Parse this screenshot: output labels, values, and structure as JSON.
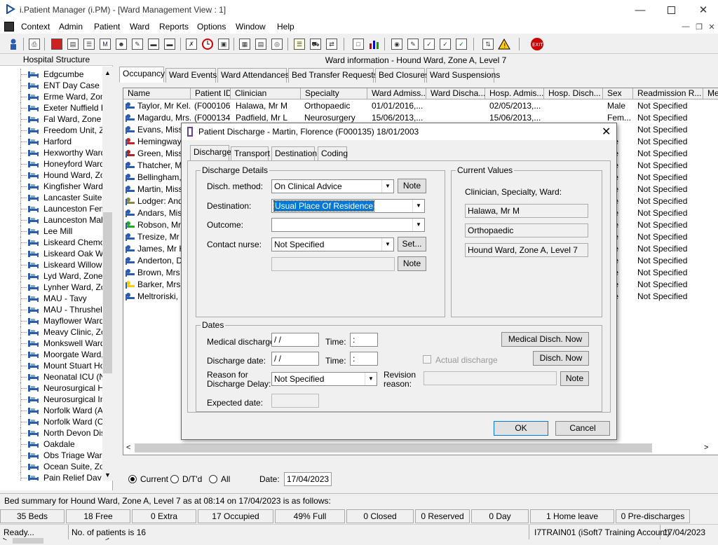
{
  "window": {
    "title": "i.Patient Manager (i.PM) - [Ward Management View : 1]"
  },
  "menu": [
    "Context",
    "Admin",
    "Patient",
    "Ward",
    "Reports",
    "Options",
    "Window",
    "Help"
  ],
  "left_panel": {
    "header": "Hospital Structure",
    "items": [
      "Edgcumbe",
      "ENT Day Case U",
      "Erme Ward, Zone",
      "Exeter Nuffield He",
      "Fal Ward, Zone E",
      "Freedom Unit, Zo",
      "Harford",
      "Hexworthy Ward,",
      "Honeyford Ward,",
      "Hound Ward, Zor",
      "Kingfisher Ward",
      "Lancaster Suite, Z",
      "Launceston Fema",
      "Launceston Male",
      "Lee Mill",
      "Liskeard Chemo D",
      "Liskeard Oak Wa",
      "Liskeard Willow V",
      "Lyd Ward, Zone I",
      "Lynher Ward, Zor",
      "MAU - Tavy",
      "MAU - Thrushel",
      "Mayflower Ward,",
      "Meavy Clinic, Zor",
      "Monkswell Ward,",
      "Moorgate Ward, Z",
      "Mount Stuart Hos",
      "Neonatal ICU (NN",
      "Neurosurgical Hig",
      "Neurosurgical Inte",
      "Norfolk Ward (Ad",
      "Norfolk Ward (Co",
      "North Devon Dist",
      "Oakdale",
      "Obs Triage Ward",
      "Ocean Suite, Zor",
      "Pain Relief Day C"
    ]
  },
  "main": {
    "ward_title": "Ward information - Hound Ward, Zone A, Level 7",
    "tabs": [
      "Occupancy",
      "Ward Events",
      "Ward Attendances",
      "Bed Transfer Requests",
      "Bed Closures",
      "Ward Suspensions"
    ],
    "columns": [
      "Name",
      "Patient ID",
      "Clinician",
      "Specialty",
      "Ward Admiss...",
      "Ward Discha...",
      "Hosp. Admis...",
      "Hosp. Disch...",
      "Sex",
      "Readmission R...",
      "Me"
    ],
    "rows": [
      {
        "name": "Taylor, Mr Kel...",
        "id": "(F000106)",
        "clin": "Halawa, Mr M",
        "spec": "Orthopaedic",
        "wadm": "01/01/2016,...",
        "hadm": "02/05/2013,...",
        "sex": "Male",
        "readm": "Not Specified",
        "icon": "blue"
      },
      {
        "name": "Magardu, Mrs...",
        "id": "(F000134)",
        "clin": "Padfield, Mr L",
        "spec": "Neurosurgery",
        "wadm": "15/06/2013,...",
        "hadm": "15/06/2013,...",
        "sex": "Fem...",
        "readm": "Not Specified",
        "icon": "blue"
      },
      {
        "name": "Evans, Miss",
        "id": "",
        "clin": "",
        "spec": "",
        "wadm": "",
        "hadm": "",
        "sex": "",
        "readm": "Not Specified",
        "icon": "blue"
      },
      {
        "name": "Hemingway,",
        "id": "",
        "clin": "",
        "spec": "",
        "wadm": "",
        "hadm": "",
        "sex": "ale",
        "readm": "Not Specified",
        "icon": "red"
      },
      {
        "name": "Green, Miss",
        "id": "",
        "clin": "",
        "spec": "",
        "wadm": "",
        "hadm": "",
        "sex": "ale",
        "readm": "Not Specified",
        "icon": "face"
      },
      {
        "name": "Thatcher, Mr",
        "id": "",
        "clin": "",
        "spec": "",
        "wadm": "",
        "hadm": "",
        "sex": "ale",
        "readm": "Not Specified",
        "icon": "blue"
      },
      {
        "name": "Bellingham,",
        "id": "",
        "clin": "",
        "spec": "",
        "wadm": "",
        "hadm": "",
        "sex": "ale",
        "readm": "Not Specified",
        "icon": "blue"
      },
      {
        "name": "Martin, Miss",
        "id": "",
        "clin": "",
        "spec": "",
        "wadm": "",
        "hadm": "",
        "sex": "ale",
        "readm": "Not Specified",
        "icon": "blue"
      },
      {
        "name": "Lodger: Anda",
        "id": "",
        "clin": "",
        "spec": "",
        "wadm": "",
        "hadm": "",
        "sex": "ale",
        "readm": "Not Specified",
        "icon": "person"
      },
      {
        "name": "Andars, Miss",
        "id": "",
        "clin": "",
        "spec": "",
        "wadm": "",
        "hadm": "",
        "sex": "ale",
        "readm": "Not Specified",
        "icon": "blue"
      },
      {
        "name": "Robson, Mr",
        "id": "",
        "clin": "",
        "spec": "",
        "wadm": "",
        "hadm": "",
        "sex": "ale",
        "readm": "Not Specified",
        "icon": "green"
      },
      {
        "name": "Tresize, Mr F",
        "id": "",
        "clin": "",
        "spec": "",
        "wadm": "",
        "hadm": "",
        "sex": "ale",
        "readm": "Not Specified",
        "icon": "blue"
      },
      {
        "name": "James, Mr H",
        "id": "",
        "clin": "",
        "spec": "",
        "wadm": "",
        "hadm": "",
        "sex": "ale",
        "readm": "Not Specified",
        "icon": "blue"
      },
      {
        "name": "Anderton, Dr",
        "id": "",
        "clin": "",
        "spec": "",
        "wadm": "",
        "hadm": "",
        "sex": "ale",
        "readm": "Not Specified",
        "icon": "blue"
      },
      {
        "name": "Brown, Mrs L",
        "id": "",
        "clin": "",
        "spec": "",
        "wadm": "",
        "hadm": "",
        "sex": "ale",
        "readm": "Not Specified",
        "icon": "blue"
      },
      {
        "name": "Barker, Mrs K",
        "id": "",
        "clin": "",
        "spec": "",
        "wadm": "",
        "hadm": "",
        "sex": "ale",
        "readm": "Not Specified",
        "icon": "yellow"
      },
      {
        "name": "Meltroriski, M",
        "id": "",
        "clin": "",
        "spec": "",
        "wadm": "",
        "hadm": "",
        "sex": "ale",
        "readm": "Not Specified",
        "icon": "blue"
      }
    ],
    "radio_current": "Current",
    "radio_dtd": "D/T'd",
    "radio_all": "All",
    "date_label": "Date:",
    "date_value": "17/04/2023"
  },
  "dialog": {
    "title": "Patient Discharge - Martin, Florence (F000135) 18/01/2003",
    "tabs": [
      "Discharge",
      "Transport",
      "Destination",
      "Coding"
    ],
    "discharge_details_caption": "Discharge Details",
    "disch_method_label": "Disch. method:",
    "disch_method_value": "On Clinical Advice",
    "destination_label": "Destination:",
    "destination_value": "Usual Place Of Residence",
    "outcome_label": "Outcome:",
    "outcome_value": "",
    "contact_nurse_label": "Contact nurse:",
    "contact_nurse_value": "Not Specified",
    "note_label": "Note",
    "set_label": "Set...",
    "current_values_caption": "Current Values",
    "cv_label": "Clinician, Specialty, Ward:",
    "cv_clinician": "Halawa, Mr M",
    "cv_specialty": "Orthopaedic",
    "cv_ward": "Hound Ward, Zone A, Level 7",
    "dates_caption": "Dates",
    "medical_discharge_label": "Medical discharge:",
    "medical_discharge_value": " / /",
    "time_label": "Time:",
    "time_value": " :",
    "medical_disch_now": "Medical Disch. Now",
    "discharge_date_label": "Discharge date:",
    "discharge_date_value": " / /",
    "actual_discharge_label": "Actual discharge",
    "disch_now": "Disch. Now",
    "reason_label_1": "Reason for",
    "reason_label_2": "Discharge Delay:",
    "reason_value": "Not Specified",
    "revision_label_1": "Revision",
    "revision_label_2": "reason:",
    "expected_date_label": "Expected date:",
    "ok": "OK",
    "cancel": "Cancel"
  },
  "status": {
    "summary": "Bed summary for Hound Ward, Zone A, Level 7 as at 08:14 on 17/04/2023 is as follows:",
    "boxes": [
      "35 Beds",
      "18 Free",
      "0 Extra",
      "17 Occupied",
      "49% Full",
      "0 Closed",
      "0 Reserved",
      "0 Day",
      "1 Home leave",
      "0 Pre-discharges"
    ],
    "ready": "Ready...",
    "patients": "No. of patients is 16",
    "user": "I7TRAIN01 (iSoft7 Training Account)",
    "date": "17/04/2023"
  },
  "colors": {
    "selection": "#0078d7",
    "exit_red": "#cc0000"
  }
}
